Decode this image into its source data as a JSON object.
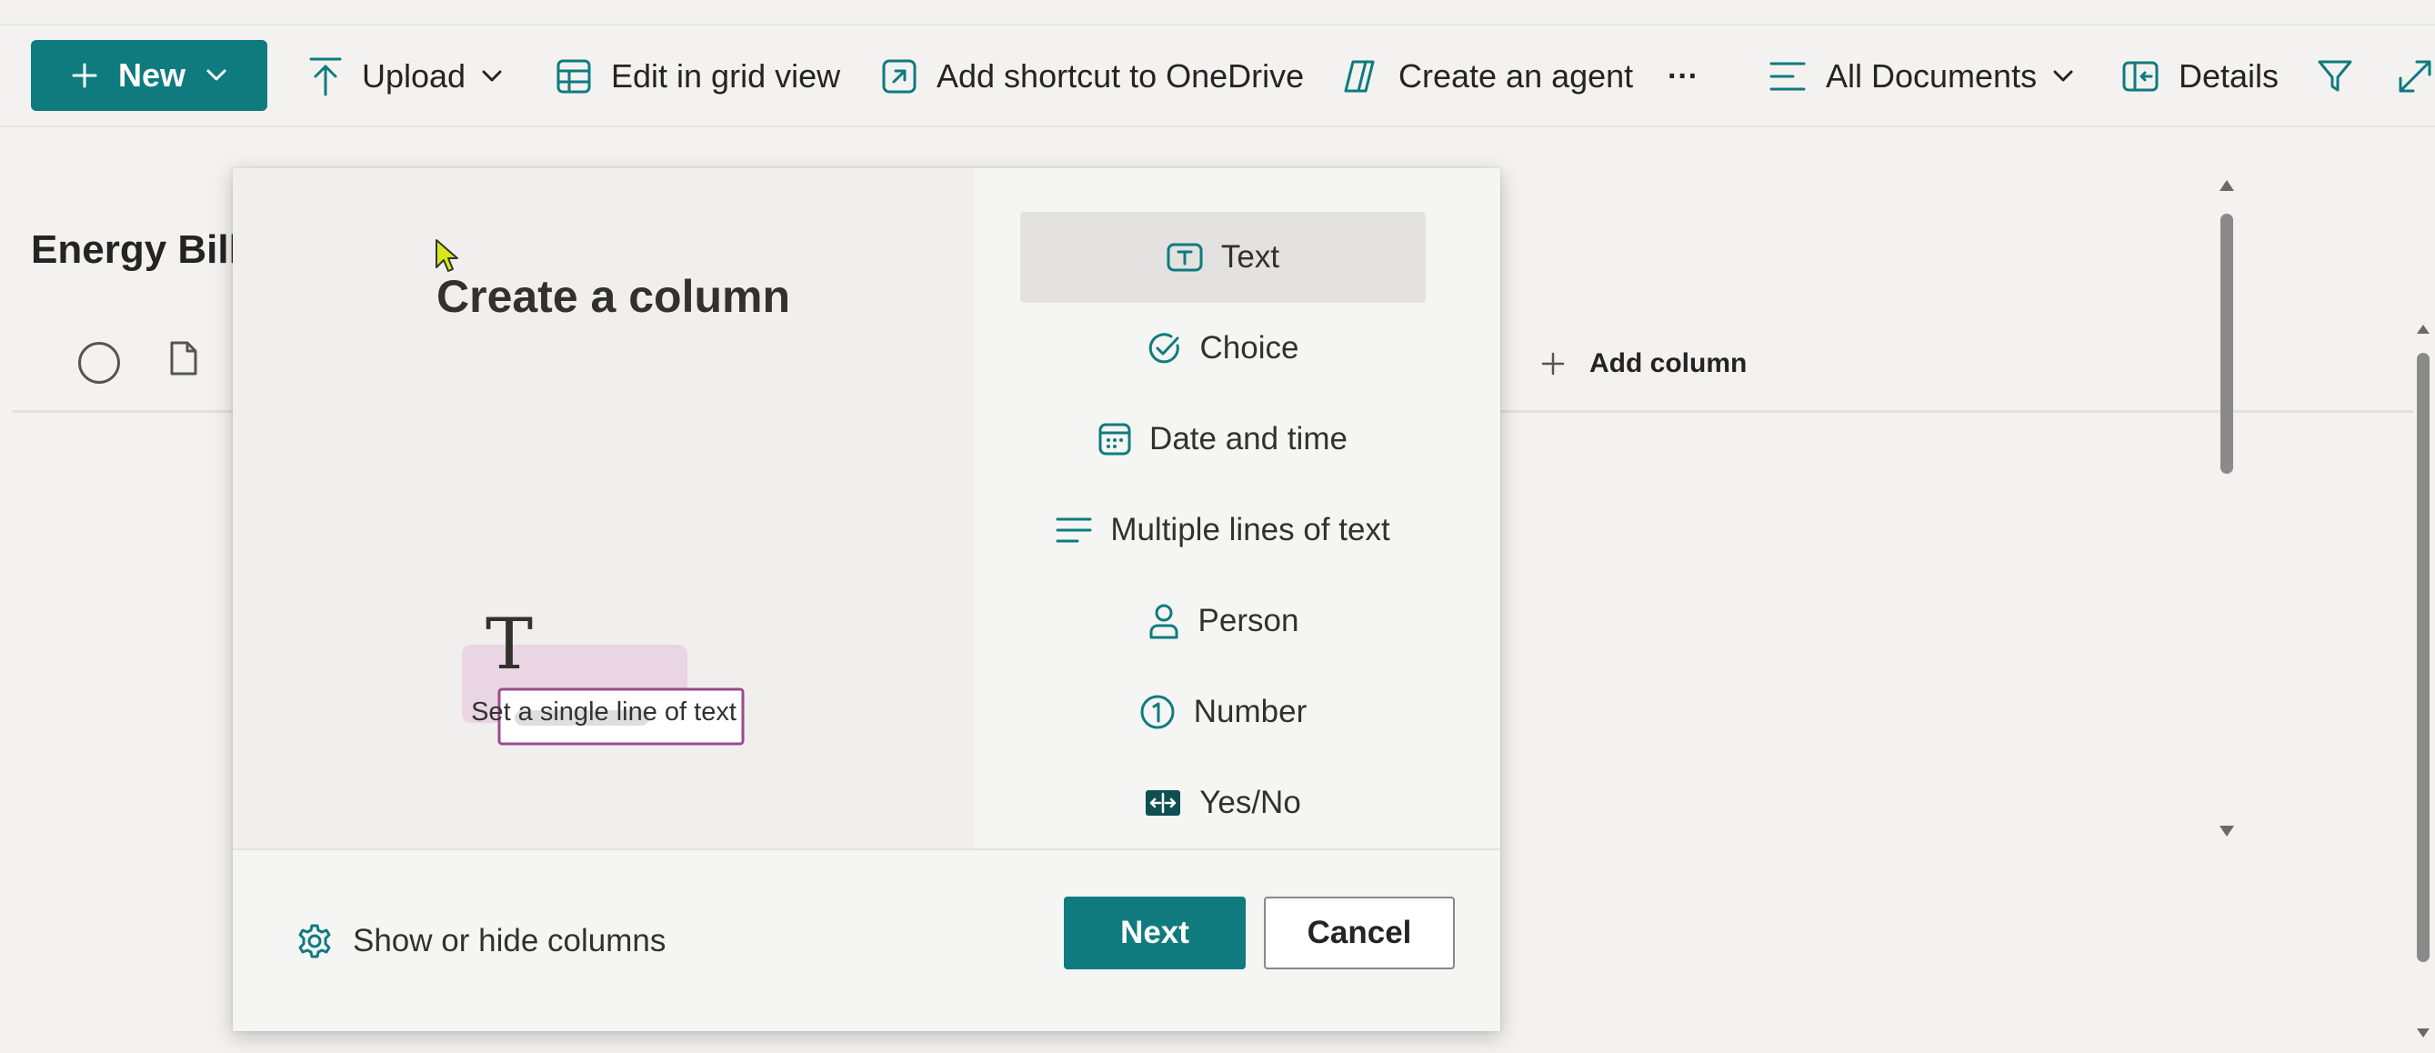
{
  "colors": {
    "accent": "#0f7b7e",
    "illus_pink": "#ead5e2",
    "illus_border": "#9a4a8c"
  },
  "toolbar": {
    "new_label": "New",
    "upload_label": "Upload",
    "edit_grid_label": "Edit in grid view",
    "add_shortcut_label": "Add shortcut to OneDrive",
    "create_agent_label": "Create an agent",
    "more_label": "···",
    "view_label": "All Documents",
    "details_label": "Details"
  },
  "library": {
    "title": "Energy Bills",
    "add_column_label": "Add column"
  },
  "dialog": {
    "title": "Create a column",
    "illustration_glyph": "T",
    "description": "Set a single line of text",
    "column_types": [
      {
        "label": "Text",
        "icon": "text-type-icon",
        "selected": true
      },
      {
        "label": "Choice",
        "icon": "choice-check-icon",
        "selected": false
      },
      {
        "label": "Date and time",
        "icon": "calendar-icon",
        "selected": false
      },
      {
        "label": "Multiple lines of text",
        "icon": "multiline-text-icon",
        "selected": false
      },
      {
        "label": "Person",
        "icon": "person-icon",
        "selected": false
      },
      {
        "label": "Number",
        "icon": "number-icon",
        "selected": false
      },
      {
        "label": "Yes/No",
        "icon": "yes-no-icon",
        "selected": false
      }
    ],
    "show_hide_label": "Show or hide columns",
    "next_label": "Next",
    "cancel_label": "Cancel"
  }
}
